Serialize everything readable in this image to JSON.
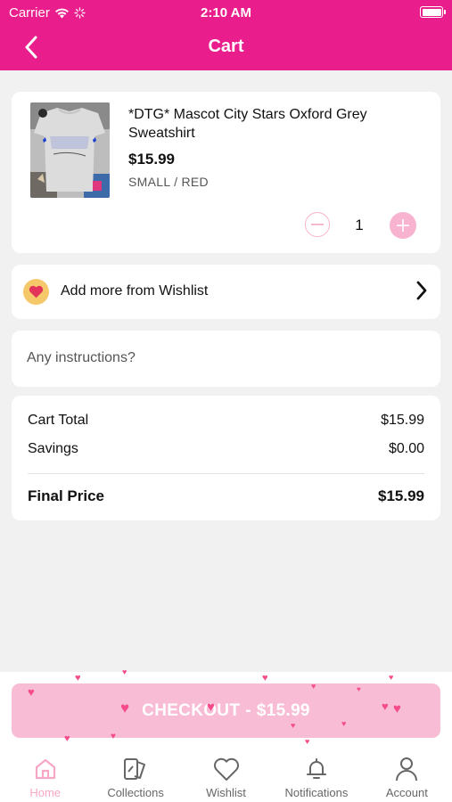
{
  "status_bar": {
    "carrier": "Carrier",
    "time": "2:10 AM"
  },
  "nav": {
    "title": "Cart"
  },
  "cart_item": {
    "name": "*DTG* Mascot City Stars Oxford Grey Sweatshirt",
    "price": "$15.99",
    "variant": "SMALL / RED",
    "quantity": "1"
  },
  "wishlist": {
    "label": "Add more from Wishlist"
  },
  "instructions": {
    "placeholder": "Any instructions?"
  },
  "summary": {
    "cart_total_label": "Cart Total",
    "cart_total_value": "$15.99",
    "savings_label": "Savings",
    "savings_value": "$0.00",
    "final_label": "Final Price",
    "final_value": "$15.99"
  },
  "checkout": {
    "label": "CHECKOUT",
    "separator": "-",
    "amount": "$15.99"
  },
  "tabs": [
    {
      "label": "Home",
      "icon": "home-icon",
      "active": true
    },
    {
      "label": "Collections",
      "icon": "collections-icon",
      "active": false
    },
    {
      "label": "Wishlist",
      "icon": "heart-icon",
      "active": false
    },
    {
      "label": "Notifications",
      "icon": "bell-icon",
      "active": false
    },
    {
      "label": "Account",
      "icon": "person-icon",
      "active": false
    }
  ],
  "colors": {
    "brand": "#e91e8c",
    "accent_light": "#f9bcd5",
    "quantity_button": "#f7b3cf"
  }
}
